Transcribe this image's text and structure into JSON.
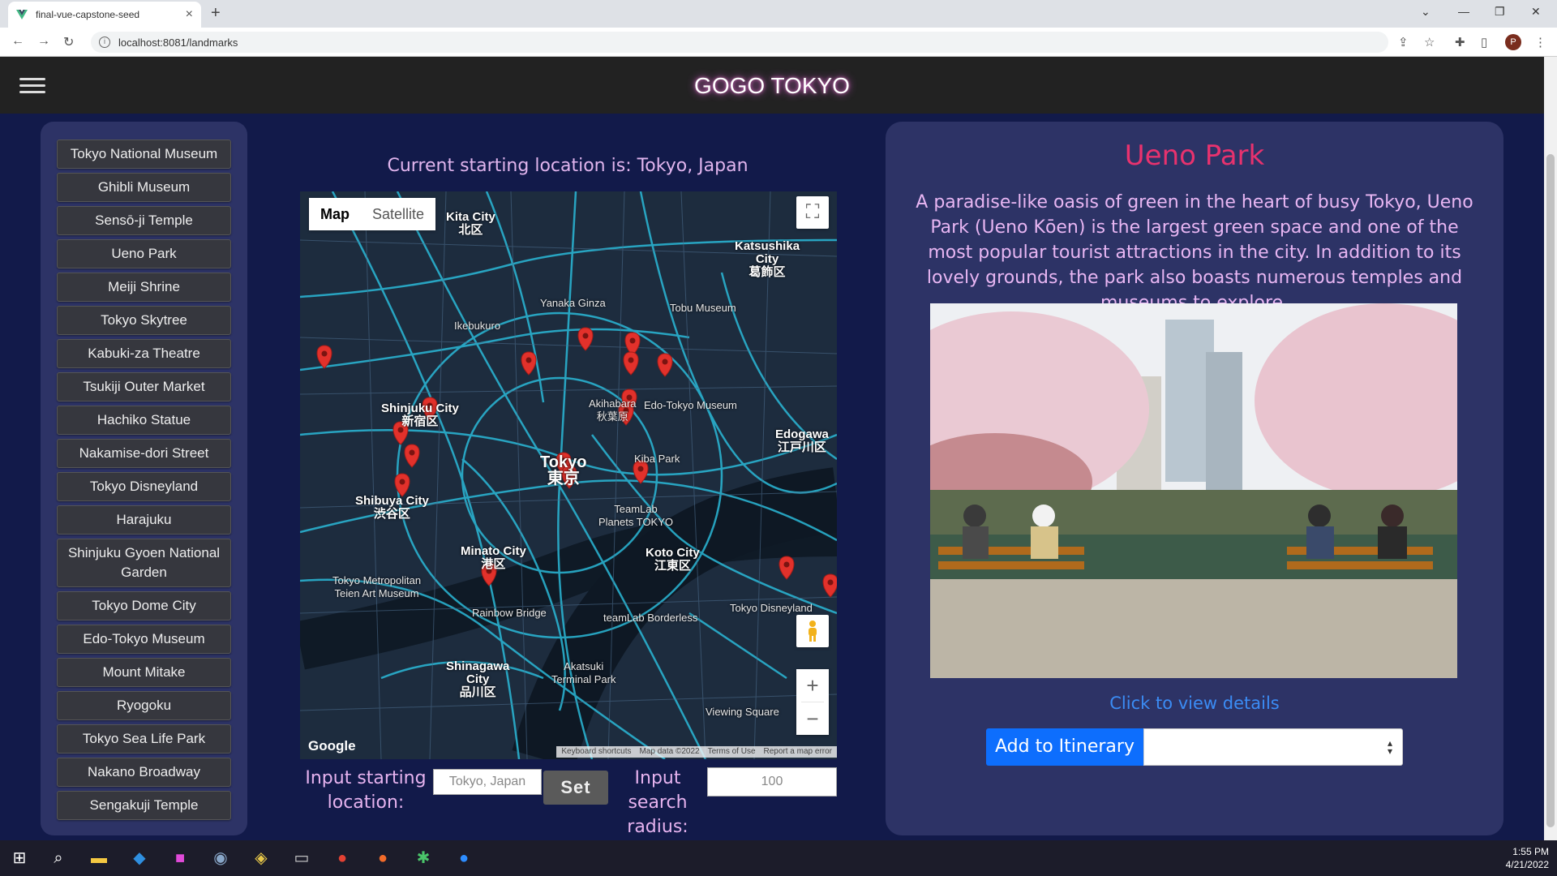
{
  "browser": {
    "tab_title": "final-vue-capstone-seed",
    "url": "localhost:8081/landmarks",
    "profile_initial": "P"
  },
  "app": {
    "title": "GOGO TOKYO"
  },
  "sidebar": {
    "items": [
      {
        "label": "Tokyo National Museum"
      },
      {
        "label": "Ghibli Museum"
      },
      {
        "label": "Sensō-ji Temple"
      },
      {
        "label": "Ueno Park"
      },
      {
        "label": "Meiji Shrine"
      },
      {
        "label": "Tokyo Skytree"
      },
      {
        "label": "Kabuki-za Theatre"
      },
      {
        "label": "Tsukiji Outer Market"
      },
      {
        "label": "Hachiko Statue"
      },
      {
        "label": "Nakamise-dori Street"
      },
      {
        "label": "Tokyo Disneyland"
      },
      {
        "label": "Harajuku"
      },
      {
        "label": "Shinjuku Gyoen National Garden"
      },
      {
        "label": "Tokyo Dome City"
      },
      {
        "label": "Edo-Tokyo Museum"
      },
      {
        "label": "Mount Mitake"
      },
      {
        "label": "Ryogoku"
      },
      {
        "label": "Tokyo Sea Life Park"
      },
      {
        "label": "Nakano Broadway"
      },
      {
        "label": "Sengakuji Temple"
      }
    ]
  },
  "map": {
    "current_location_text": "Current starting location is: Tokyo, Japan",
    "type_map": "Map",
    "type_satellite": "Satellite",
    "google": "Google",
    "attribution": {
      "shortcuts": "Keyboard shortcuts",
      "data": "Map data ©2022",
      "terms": "Terms of Use",
      "report": "Report a map error"
    },
    "labels": {
      "tokyo": "Tokyo\n東京",
      "shinjuku": "Shinjuku City\n新宿区",
      "shibuya": "Shibuya City\n渋谷区",
      "minato": "Minato City\n港区",
      "koto": "Koto City\n江東区",
      "shinagawa": "Shinagawa\nCity\n品川区",
      "katsushika": "Katsushika\nCity\n葛飾区",
      "edogawa": "Edogawa\n江戸川区",
      "kita": "Kita City\n北区",
      "akihabara": "Akihabara\n秋葉原",
      "edotokyo": "Edo-Tokyo Museum",
      "tobu": "Tobu Museum",
      "teamlab": "TeamLab\nPlanets TOKYO",
      "disneyland": "Tokyo Disneyland",
      "rainbow": "Rainbow Bridge",
      "yanaka": "Yanaka Ginza",
      "ikebukuro": "Ikebukuro",
      "kibapark": "Kiba Park",
      "akatsuki": "Akatsuki\nTerminal Park",
      "viewing": "Viewing Square",
      "metmuseum": "Tokyo Metropolitan\nTeien Art Museum",
      "teamlabborderless": "teamLab Borderless"
    }
  },
  "inputs": {
    "start_label": "Input starting location:",
    "start_value": "Tokyo, Japan",
    "set_label": "Set",
    "radius_label": "Input search radius:",
    "radius_value": "100"
  },
  "detail": {
    "title": "Ueno Park",
    "description": "A paradise-like oasis of green in the heart of busy Tokyo, Ueno Park (Ueno Kōen) is the largest green space and one of the most popular tourist attractions in the city. In addition to its lovely grounds, the park also boasts numerous temples and museums to explore.",
    "view_details": "Click to view details",
    "add_itinerary": "Add to Itinerary",
    "itinerary_selected": ""
  },
  "taskbar": {
    "time": "1:55 PM",
    "date": "4/21/2022"
  },
  "colors": {
    "accent_pink": "#e8326e",
    "text_lavender": "#e8b6f3",
    "link_blue": "#3b8cf5",
    "button_blue": "#0d6efd",
    "panel": "#2d3366",
    "background": "#121a4a"
  }
}
